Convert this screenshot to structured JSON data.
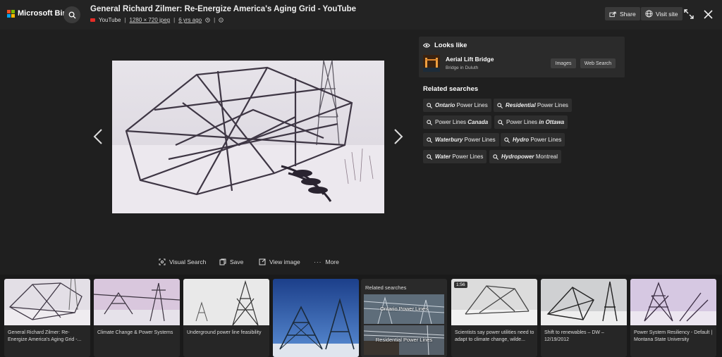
{
  "brand": {
    "name": "Microsoft Bing",
    "colors": [
      "#f25022",
      "#7fba00",
      "#00a4ef",
      "#ffb900"
    ]
  },
  "header": {
    "title": "General Richard Zilmer: Re-Energize America's Aging Grid - YouTube",
    "source": "YouTube",
    "dimensions": "1280 × 720 jpeg",
    "age": "6 yrs ago",
    "share_label": "Share",
    "visit_label": "Visit site"
  },
  "actions": {
    "visual_search": "Visual Search",
    "save": "Save",
    "view_image": "View image",
    "more": "More"
  },
  "looks_like": {
    "heading": "Looks like",
    "name": "Aerial Lift Bridge",
    "subtitle": "Bridge in Duluth",
    "images_btn": "Images",
    "web_btn": "Web Search"
  },
  "related": {
    "heading": "Related searches",
    "chips": [
      {
        "bold": "Ontario",
        "rest": " Power Lines",
        "order": "bold-first"
      },
      {
        "bold": "Residential",
        "rest": " Power Lines",
        "order": "bold-first"
      },
      {
        "bold": " Canada",
        "rest": "Power Lines",
        "order": "rest-first"
      },
      {
        "bold": " in Ottawa",
        "rest": "Power Lines",
        "order": "rest-first"
      },
      {
        "bold": "Waterbury",
        "rest": " Power Lines",
        "order": "bold-first"
      },
      {
        "bold": "Hydro",
        "rest": " Power Lines",
        "order": "bold-first"
      },
      {
        "bold": "Water",
        "rest": " Power Lines",
        "order": "bold-first"
      },
      {
        "bold": "Hydropower",
        "rest": " Montreal",
        "order": "bold-first"
      }
    ]
  },
  "strip": {
    "cards": [
      {
        "caption": "General Richard Zilmer: Re-Energize America's Aging Grid -..."
      },
      {
        "caption": "Climate Change & Power Systems"
      },
      {
        "caption": "Underground power line feasibility"
      },
      {
        "caption": ""
      },
      {
        "caption": "Scientists say power utilities need to adapt to climate change, wilde...",
        "badge": "1:56"
      },
      {
        "caption": "Shift to renewables – DW – 12/19/2012"
      },
      {
        "caption": "Power System Resiliency - Default | Montana State University"
      }
    ],
    "related_heading": "Related searches",
    "related_tiles": [
      "Ontario Power Lines",
      "Residential Power Lines"
    ]
  }
}
